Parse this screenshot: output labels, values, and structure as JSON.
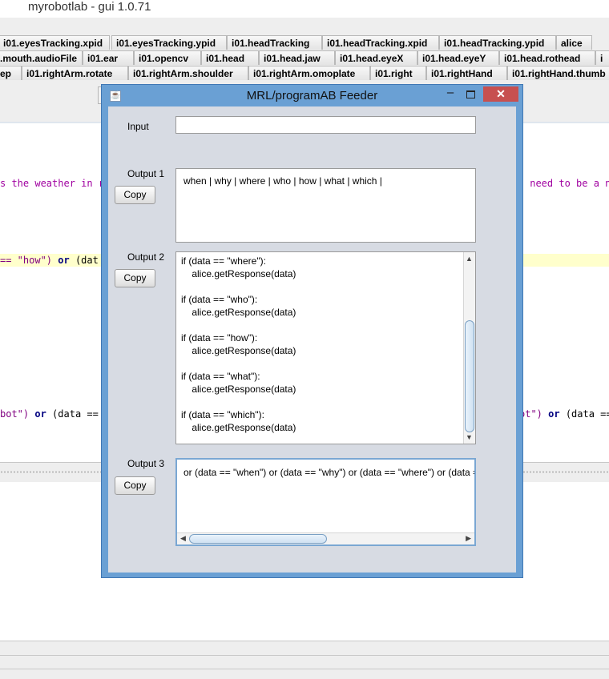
{
  "app": {
    "title": "myrobotlab - gui 1.0.71"
  },
  "tabs": {
    "row1": [
      "i01.eyesTracking.xpid",
      "i01.eyesTracking.ypid",
      "i01.headTracking",
      "i01.headTracking.xpid",
      "i01.headTracking.ypid",
      "alice"
    ],
    "row2": [
      ".mouth.audioFile",
      "i01.ear",
      "i01.opencv",
      "i01.head",
      "i01.head.jaw",
      "i01.head.eyeX",
      "i01.head.eyeY",
      "i01.head.rothead",
      "i"
    ],
    "row3": [
      "ep",
      "i01.rightArm.rotate",
      "i01.rightArm.shoulder",
      "i01.rightArm.omoplate",
      "i01.right",
      "i01.rightHand",
      "i01.rightHand.thumb"
    ]
  },
  "editor": {
    "line1_left": "s the weather in r",
    "line1_right": " need to be a ni",
    "line2_str": "== \"how\")",
    "line2_kw": "or",
    "line2_tail": "(dat",
    "line3_str": "bot\")",
    "line3_kw": "or",
    "line3_tail": "(data ==",
    "line3_right_str": "ot\")",
    "line3_right_kw": "or",
    "line3_right_tail": "(data =="
  },
  "dialog": {
    "title": "MRL/programAB Feeder",
    "java_icon": "java-icon",
    "input_label": "Input",
    "input_value": "",
    "copy_label": "Copy",
    "output1_label": "Output 1",
    "output1_text": "when | why | where | who | how | what | which |",
    "output2_label": "Output 2",
    "output2_lines": [
      "if (data == \"where\"):",
      "    alice.getResponse(data)",
      "",
      "if (data == \"who\"):",
      "    alice.getResponse(data)",
      "",
      "if (data == \"how\"):",
      "    alice.getResponse(data)",
      "",
      "if (data == \"what\"):",
      "    alice.getResponse(data)",
      "",
      "if (data == \"which\"):",
      "    alice.getResponse(data)"
    ],
    "output3_label": "Output 3",
    "output3_text": "or (data == \"when\") or (data == \"why\") or (data == \"where\") or (data == \"who\")"
  },
  "colors": {
    "dialog_frame": "#6aa0d4",
    "close_button": "#c75050",
    "editor_highlight": "#ffffcc",
    "string_color": "#800080",
    "keyword_color": "#000080"
  }
}
